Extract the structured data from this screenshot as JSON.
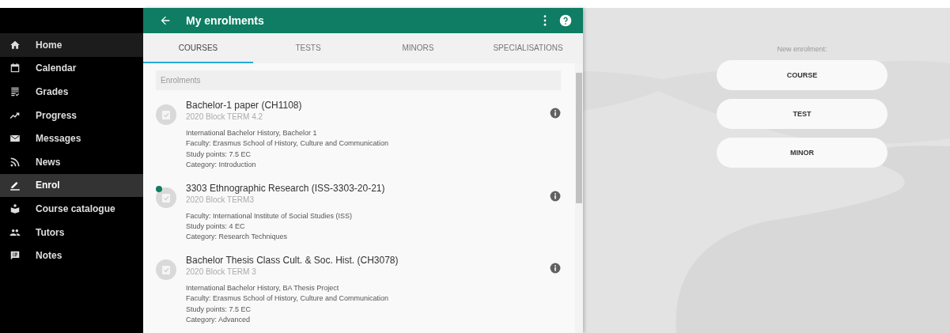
{
  "sidebar": {
    "items": [
      {
        "label": "Home",
        "kind": "home",
        "selected": false,
        "hovered": true
      },
      {
        "label": "Calendar",
        "kind": "calendar",
        "selected": false,
        "hovered": false
      },
      {
        "label": "Grades",
        "kind": "list",
        "selected": false,
        "hovered": false
      },
      {
        "label": "Progress",
        "kind": "trend",
        "selected": false,
        "hovered": false
      },
      {
        "label": "Messages",
        "kind": "mail",
        "selected": false,
        "hovered": false
      },
      {
        "label": "News",
        "kind": "rss",
        "selected": false,
        "hovered": false
      },
      {
        "label": "Enrol",
        "kind": "pen",
        "selected": true,
        "hovered": false
      },
      {
        "label": "Course catalogue",
        "kind": "book",
        "selected": false,
        "hovered": false
      },
      {
        "label": "Tutors",
        "kind": "people",
        "selected": false,
        "hovered": false
      },
      {
        "label": "Notes",
        "kind": "note",
        "selected": false,
        "hovered": false
      }
    ]
  },
  "header": {
    "title": "My enrolments"
  },
  "tabs": [
    {
      "label": "COURSES",
      "selected": true
    },
    {
      "label": "TESTS",
      "selected": false
    },
    {
      "label": "MINORS",
      "selected": false
    },
    {
      "label": "SPECIALISATIONS",
      "selected": false
    }
  ],
  "section_label": "Enrolments",
  "enrolments": [
    {
      "title": "Bachelor-1 paper (CH1108)",
      "subtitle": "2020 Block TERM 4.2",
      "new": false,
      "details": [
        "International Bachelor History, Bachelor 1",
        "Faculty: Erasmus School of History, Culture and Communication",
        "Study points: 7.5 EC",
        "Category: Introduction"
      ]
    },
    {
      "title": "3303 Ethnographic Research (ISS-3303-20-21)",
      "subtitle": "2020 Block TERM3",
      "new": true,
      "details": [
        "Faculty: International Institute of Social Studies (ISS)",
        "Study points: 4 EC",
        "Category: Research Techniques"
      ]
    },
    {
      "title": "Bachelor Thesis Class Cult. & Soc. Hist. (CH3078)",
      "subtitle": "2020 Block TERM 3",
      "new": false,
      "details": [
        "International Bachelor History, BA Thesis Project",
        "Faculty: Erasmus School of History, Culture and Communication",
        "Study points: 7.5 EC",
        "Category: Advanced"
      ]
    }
  ],
  "new_enrolment": {
    "label": "New enrolment:",
    "buttons": [
      "COURSE",
      "TEST",
      "MINOR"
    ]
  }
}
